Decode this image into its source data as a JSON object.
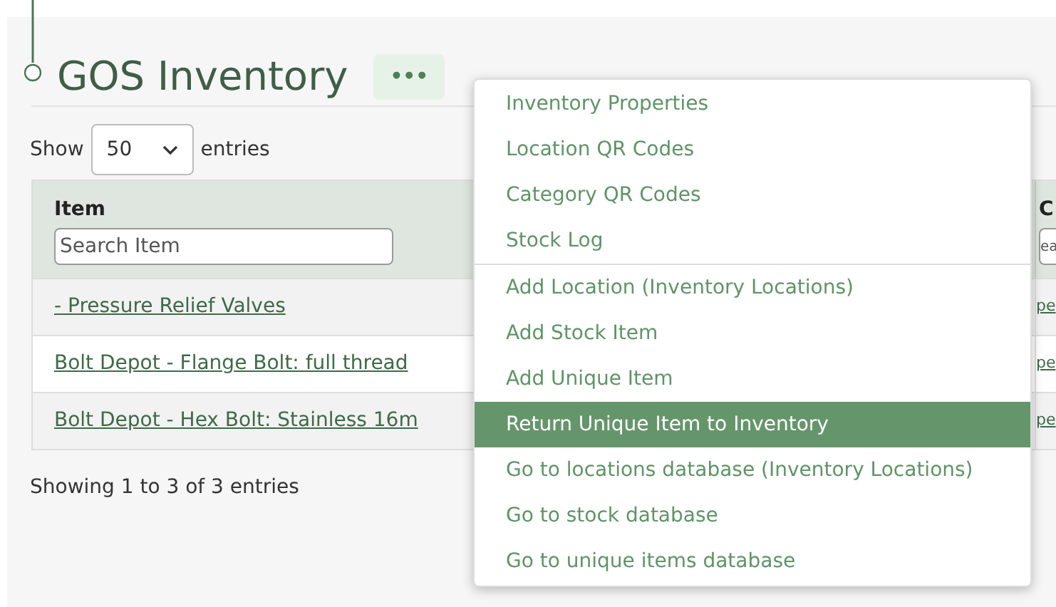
{
  "page": {
    "title": "GOS Inventory",
    "more_button": "•••"
  },
  "length_menu": {
    "before": "Show",
    "value": "50",
    "after": "entries"
  },
  "table": {
    "columns": [
      {
        "header": "Item",
        "search_placeholder": "Search Item"
      },
      {
        "header": "C",
        "search_placeholder": "ea"
      }
    ],
    "rows": [
      [
        "- Pressure Relief Valves",
        "pe"
      ],
      [
        "Bolt Depot - Flange Bolt: full thread",
        "pe"
      ],
      [
        "Bolt Depot - Hex Bolt: Stainless 16m",
        "pe"
      ]
    ]
  },
  "info": "Showing 1 to 3 of 3 entries",
  "menu": {
    "items": [
      {
        "label": "Inventory Properties",
        "selected": false,
        "divider_after": false
      },
      {
        "label": "Location QR Codes",
        "selected": false,
        "divider_after": false
      },
      {
        "label": "Category QR Codes",
        "selected": false,
        "divider_after": false
      },
      {
        "label": "Stock Log",
        "selected": false,
        "divider_after": true
      },
      {
        "label": "Add Location (Inventory Locations)",
        "selected": false,
        "divider_after": false
      },
      {
        "label": "Add Stock Item",
        "selected": false,
        "divider_after": false
      },
      {
        "label": "Add Unique Item",
        "selected": false,
        "divider_after": false
      },
      {
        "label": "Return Unique Item to Inventory",
        "selected": true,
        "divider_after": false
      },
      {
        "label": "Go to locations database (Inventory Locations)",
        "selected": false,
        "divider_after": false
      },
      {
        "label": "Go to stock database",
        "selected": false,
        "divider_after": false
      },
      {
        "label": "Go to unique items database",
        "selected": false,
        "divider_after": false
      }
    ]
  }
}
